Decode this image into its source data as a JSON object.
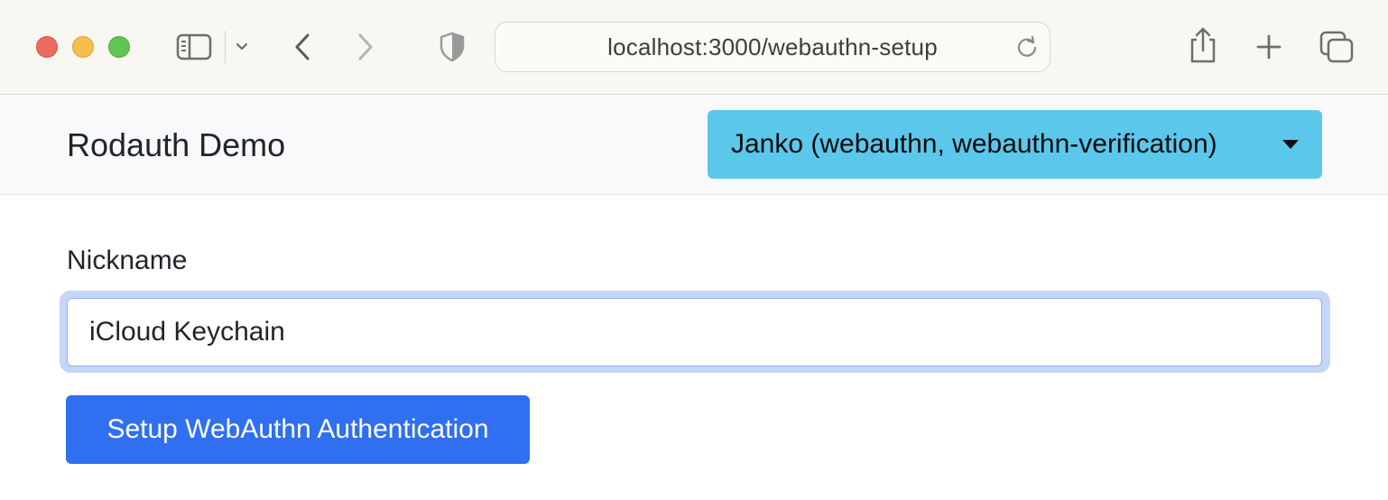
{
  "browser": {
    "url": "localhost:3000/webauthn-setup",
    "icons": [
      "close-icon",
      "minimize-icon",
      "zoom-icon",
      "sidebar-icon",
      "chevron-down-icon",
      "back-icon",
      "forward-icon",
      "shield-icon",
      "reload-icon",
      "share-icon",
      "plus-icon",
      "tabs-icon"
    ]
  },
  "navbar": {
    "brand": "Rodauth Demo",
    "user_menu_label": "Janko (webauthn, webauthn-verification)",
    "user_menu_color": "#5bc7eb"
  },
  "form": {
    "nickname_label": "Nickname",
    "nickname_value": "iCloud Keychain",
    "submit_label": "Setup WebAuthn Authentication",
    "submit_color": "#2f6ff0"
  }
}
